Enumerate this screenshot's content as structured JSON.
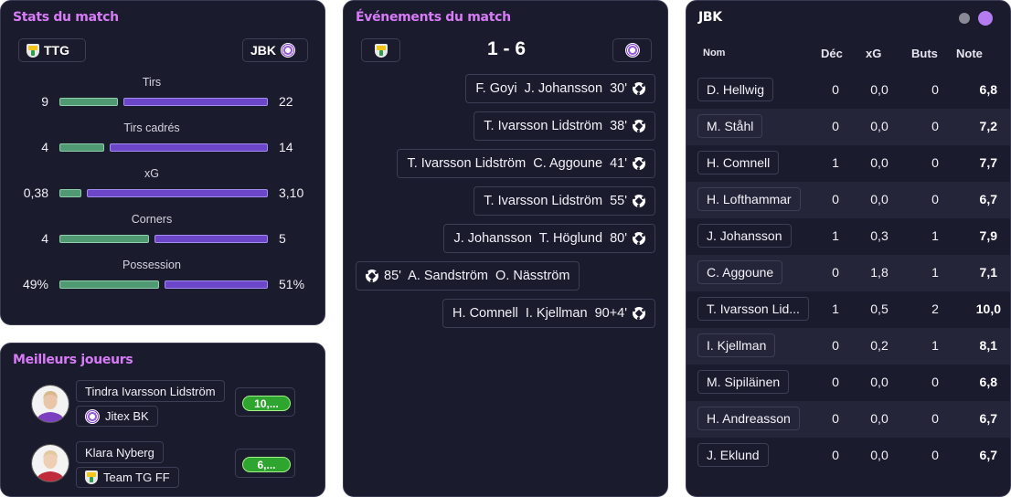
{
  "stats": {
    "title": "Stats du match",
    "home_team": "TTG",
    "away_team": "JBK",
    "rows": [
      {
        "label": "Tirs",
        "home": "9",
        "away": "22",
        "home_share": 0.29
      },
      {
        "label": "Tirs cadrés",
        "home": "4",
        "away": "14",
        "home_share": 0.22
      },
      {
        "label": "xG",
        "home": "0,38",
        "away": "3,10",
        "home_share": 0.11
      },
      {
        "label": "Corners",
        "home": "4",
        "away": "5",
        "home_share": 0.44
      },
      {
        "label": "Possession",
        "home": "49%",
        "away": "51%",
        "home_share": 0.49
      }
    ]
  },
  "top_players": {
    "title": "Meilleurs joueurs",
    "players": [
      {
        "name": "Tindra Ivarsson Lidström",
        "team": "Jitex BK",
        "rating": "10,..."
      },
      {
        "name": "Klara Nyberg",
        "team": "Team TG FF",
        "rating": "6,..."
      }
    ]
  },
  "events": {
    "title": "Événements du match",
    "score": "1 - 6",
    "items": [
      {
        "text": "F. Goyi  J. Johansson  30'",
        "side": "away"
      },
      {
        "text": "T. Ivarsson Lidström  38'",
        "side": "away"
      },
      {
        "text": "T. Ivarsson Lidström  C. Aggoune  41'",
        "side": "away"
      },
      {
        "text": "T. Ivarsson Lidström  55'",
        "side": "away"
      },
      {
        "text": "J. Johansson  T. Höglund  80'",
        "side": "away"
      },
      {
        "text": "85'  A. Sandström  O. Näsström",
        "side": "home"
      },
      {
        "text": "H. Comnell  I. Kjellman  90+4'",
        "side": "away"
      }
    ]
  },
  "lineup": {
    "title": "JBK",
    "columns": {
      "name": "Nom",
      "dec": "Déc",
      "xg": "xG",
      "buts": "Buts",
      "note": "Note"
    },
    "rows": [
      {
        "name": "D. Hellwig",
        "dec": "0",
        "xg": "0,0",
        "buts": "0",
        "note": "6,8"
      },
      {
        "name": "M. Ståhl",
        "dec": "0",
        "xg": "0,0",
        "buts": "0",
        "note": "7,2"
      },
      {
        "name": "H. Comnell",
        "dec": "1",
        "xg": "0,0",
        "buts": "0",
        "note": "7,7"
      },
      {
        "name": "H. Lofthammar",
        "dec": "0",
        "xg": "0,0",
        "buts": "0",
        "note": "6,7"
      },
      {
        "name": "J. Johansson",
        "dec": "1",
        "xg": "0,3",
        "buts": "1",
        "note": "7,9"
      },
      {
        "name": "C. Aggoune",
        "dec": "0",
        "xg": "1,8",
        "buts": "1",
        "note": "7,1"
      },
      {
        "name": "T. Ivarsson Lid...",
        "dec": "1",
        "xg": "0,5",
        "buts": "2",
        "note": "10,0"
      },
      {
        "name": "I. Kjellman",
        "dec": "0",
        "xg": "0,2",
        "buts": "1",
        "note": "8,1"
      },
      {
        "name": "M. Sipiläinen",
        "dec": "0",
        "xg": "0,0",
        "buts": "0",
        "note": "6,8"
      },
      {
        "name": "H. Andreasson",
        "dec": "0",
        "xg": "0,0",
        "buts": "0",
        "note": "6,7"
      },
      {
        "name": "J. Eklund",
        "dec": "0",
        "xg": "0,0",
        "buts": "0",
        "note": "6,7"
      }
    ]
  },
  "colors": {
    "accent": "#d77cf6",
    "home_bar": "#4f9a72",
    "away_bar": "#6b46c9",
    "rating_green": "#2ea52e",
    "panel_bg": "#1b1b2e"
  }
}
